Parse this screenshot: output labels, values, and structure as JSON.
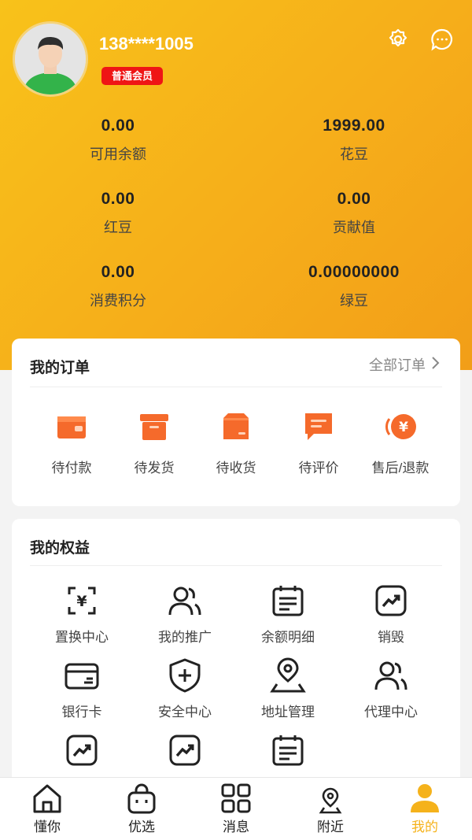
{
  "profile": {
    "phone": "138****1005",
    "member_badge": "普通会员"
  },
  "header_icons": [
    "gear-icon",
    "more-chat-icon"
  ],
  "stats": [
    {
      "value": "0.00",
      "label": "可用余额"
    },
    {
      "value": "1999.00",
      "label": "花豆"
    },
    {
      "value": "0.00",
      "label": "红豆"
    },
    {
      "value": "0.00",
      "label": "贡献值"
    },
    {
      "value": "0.00",
      "label": "消费积分"
    },
    {
      "value": "0.00000000",
      "label": "绿豆"
    }
  ],
  "orders": {
    "title": "我的订单",
    "all_link": "全部订单",
    "items": [
      {
        "label": "待付款",
        "icon": "wallet-icon"
      },
      {
        "label": "待发货",
        "icon": "box-icon"
      },
      {
        "label": "待收货",
        "icon": "package-icon"
      },
      {
        "label": "待评价",
        "icon": "comment-icon"
      },
      {
        "label": "售后/退款",
        "icon": "refund-icon"
      }
    ]
  },
  "benefits": {
    "title": "我的权益",
    "items": [
      {
        "label": "置换中心",
        "icon": "exchange-icon"
      },
      {
        "label": "我的推广",
        "icon": "users-icon"
      },
      {
        "label": "余额明细",
        "icon": "calendar-list-icon"
      },
      {
        "label": "销毁",
        "icon": "trend-icon"
      },
      {
        "label": "银行卡",
        "icon": "bank-card-icon"
      },
      {
        "label": "安全中心",
        "icon": "shield-plus-icon"
      },
      {
        "label": "地址管理",
        "icon": "location-person-icon"
      },
      {
        "label": "代理中心",
        "icon": "users-icon"
      }
    ]
  },
  "tabs": [
    {
      "label": "懂你",
      "icon": "home-icon"
    },
    {
      "label": "优选",
      "icon": "bag-icon"
    },
    {
      "label": "消息",
      "icon": "grid-icon"
    },
    {
      "label": "附近",
      "icon": "map-pin-icon"
    },
    {
      "label": "我的",
      "icon": "user-icon"
    }
  ],
  "colors": {
    "accent": "#f5b21b",
    "order_icon": "#f56a2b",
    "badge": "#ef1515"
  }
}
